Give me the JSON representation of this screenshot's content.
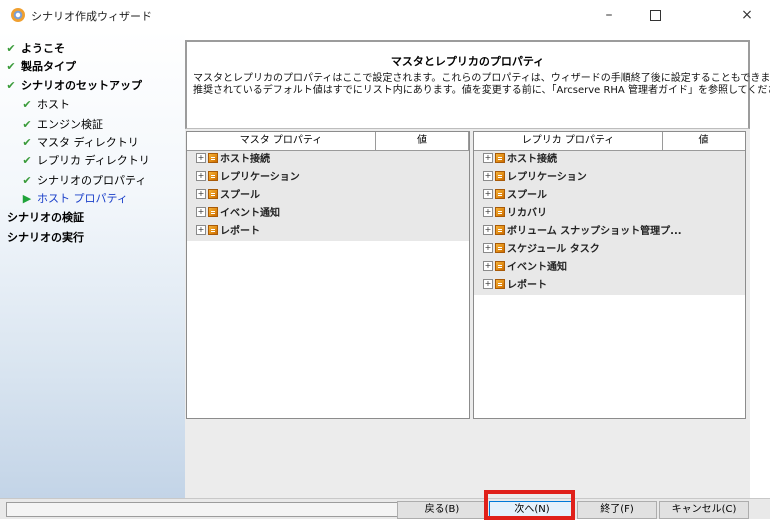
{
  "window": {
    "title": "シナリオ作成ウィザード",
    "minimize": "–",
    "close": "×"
  },
  "nav": [
    {
      "label": "ようこそ",
      "mark": "✔",
      "bold": true,
      "indent": 0
    },
    {
      "label": "製品タイプ",
      "mark": "✔",
      "bold": true,
      "indent": 0
    },
    {
      "label": "シナリオのセットアップ",
      "mark": "✔",
      "bold": true,
      "indent": 0
    },
    {
      "label": "ホスト",
      "mark": "✔",
      "bold": false,
      "indent": 1
    },
    {
      "label": "エンジン検証",
      "mark": "✔",
      "bold": false,
      "indent": 1
    },
    {
      "label": "マスタ ディレクトリ",
      "mark": "✔",
      "bold": false,
      "indent": 1
    },
    {
      "label": "レプリカ ディレクトリ",
      "mark": "✔",
      "bold": false,
      "indent": 1
    },
    {
      "label": "シナリオのプロパティ",
      "mark": "✔",
      "bold": false,
      "indent": 1
    },
    {
      "label": "ホスト プロパティ",
      "mark": "▶",
      "bold": false,
      "indent": 1,
      "current": true
    },
    {
      "label": "シナリオの検証",
      "mark": "",
      "bold": true,
      "indent": 0
    },
    {
      "label": "シナリオの実行",
      "mark": "",
      "bold": true,
      "indent": 0
    }
  ],
  "header": {
    "title": "マスタとレプリカのプロパティ",
    "desc1": "マスタとレプリカのプロパティはここで設定されます。これらのプロパティは、ウィザードの手順終了後に設定することもできます。",
    "desc2": "推奨されているデフォルト値はすでにリスト内にあります。値を変更する前に、「Arcserve RHA 管理者ガイド」を参照してください。"
  },
  "master": {
    "col_property": "マスタ プロパティ",
    "col_value": "値",
    "rows": [
      "ホスト接続",
      "レプリケーション",
      "スプール",
      "イベント通知",
      "レポート"
    ]
  },
  "replica": {
    "col_property": "レプリカ プロパティ",
    "col_value": "値",
    "rows": [
      "ホスト接続",
      "レプリケーション",
      "スプール",
      "リカバリ",
      "ボリューム スナップショット管理プ...",
      "スケジュール タスク",
      "イベント通知",
      "レポート"
    ]
  },
  "buttons": {
    "back": "戻る(B)",
    "next": "次へ(N)",
    "finish": "終了(F)",
    "cancel": "キャンセル(C)"
  },
  "expander_glyph": "+",
  "colors": {
    "highlight": "#e0201a",
    "current_item": "#1a3fc9",
    "check": "#3a9b3a"
  }
}
